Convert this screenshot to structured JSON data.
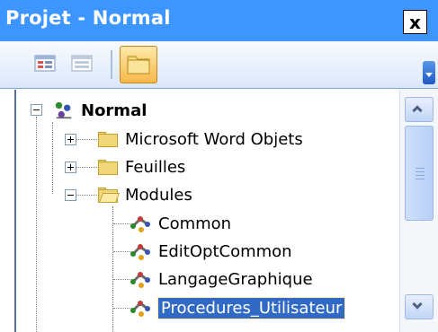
{
  "window": {
    "title": "Projet - Normal",
    "close_label": "x"
  },
  "toolbar": {
    "buttons": [
      {
        "name": "view-code",
        "icon": "view-code-icon"
      },
      {
        "name": "view-object",
        "icon": "view-object-icon"
      },
      {
        "name": "toggle-folders",
        "icon": "folder-icon",
        "active": true
      }
    ]
  },
  "tree": {
    "root": {
      "label": "Normal"
    },
    "folders": [
      {
        "label": "Microsoft Word Objets",
        "expanded": false
      },
      {
        "label": "Feuilles",
        "expanded": false
      },
      {
        "label": "Modules",
        "expanded": true
      }
    ],
    "modules": [
      {
        "label": "Common"
      },
      {
        "label": "EditOptCommon"
      },
      {
        "label": "LangageGraphique"
      },
      {
        "label": "Procedures_Utilisateur",
        "selected": true
      }
    ]
  },
  "colors": {
    "titlebar": "#3d95ff",
    "selection": "#316ac5",
    "toggle_active": "#f7b84a"
  }
}
